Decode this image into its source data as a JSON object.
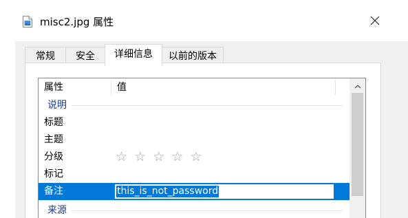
{
  "window": {
    "title": "misc2.jpg 属性"
  },
  "tabs": [
    {
      "label": "常规"
    },
    {
      "label": "安全"
    },
    {
      "label": "详细信息"
    },
    {
      "label": "以前的版本"
    }
  ],
  "active_tab": "详细信息",
  "list": {
    "columns": {
      "property": "属性",
      "value": "值"
    },
    "groups": {
      "description": "说明",
      "origin": "来源"
    },
    "rows": {
      "title": {
        "name": "标题",
        "value": ""
      },
      "subject": {
        "name": "主题",
        "value": ""
      },
      "rating": {
        "name": "分级",
        "stars": 0,
        "max_stars": 5,
        "star_glyph": "☆"
      },
      "tags": {
        "name": "标记",
        "value": ""
      },
      "comments": {
        "name": "备注",
        "value": "this_is_not_password"
      }
    }
  },
  "colors": {
    "selection": "#0078d7",
    "group_text": "#1e3f8c",
    "star": "#a0a0a0"
  },
  "icons": {
    "title": "image-file-icon",
    "close": "close-icon",
    "scroll_up": "chevron-up-icon"
  }
}
